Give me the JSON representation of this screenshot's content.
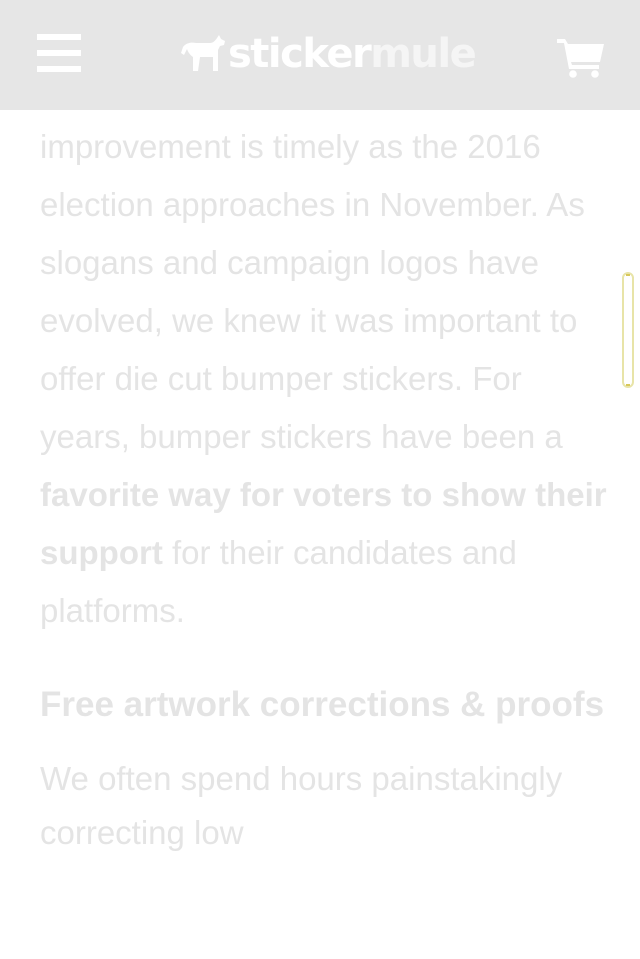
{
  "header": {
    "logo_part1": "sticker",
    "logo_part2": "mule",
    "menu_label": "menu-icon",
    "cart_label": "cart-icon",
    "background": "#e6e6e6"
  },
  "article": {
    "paragraph1": {
      "text_before": "improvement is timely as the 2016 election approaches in November. As slogans and campaign logos have evolved, we knew it was important to offer die cut bumper stickers. For years, bumper stickers have been a ",
      "bold": "favorite way for voters to show their support",
      "text_after": " for their candidates and platforms."
    },
    "heading": "Free artwork corrections & proofs",
    "paragraph2": "We often spend hours painstakingly correcting low"
  },
  "colors": {
    "text": "#e4e4e4",
    "header_bg": "#e6e6e6",
    "scrollbar_border": "#e8e4a8"
  }
}
